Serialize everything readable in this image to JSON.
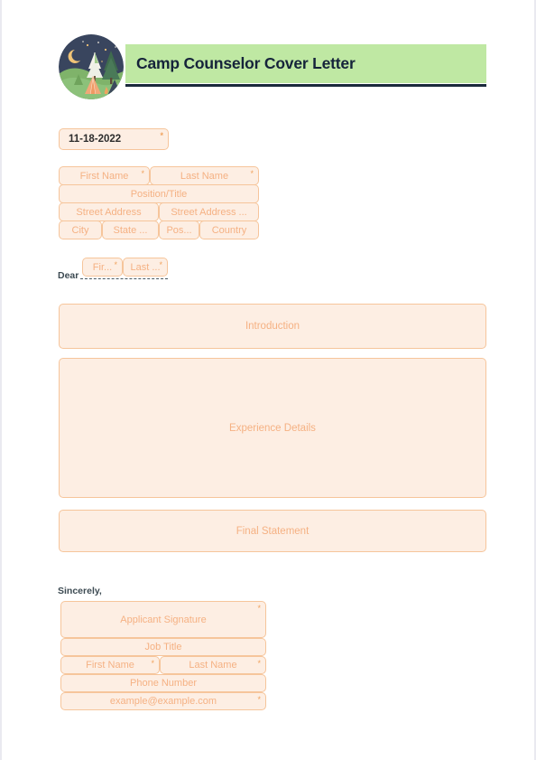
{
  "document": {
    "title": "Camp Counselor Cover Letter",
    "logo_icon": "campsite-night-scene-icon",
    "accent_color": "#bfe8a3",
    "field_border_color": "#f6c59b",
    "field_fill_color": "#fdeee3",
    "placeholder_color": "#f5b183",
    "required_marker": "*"
  },
  "date_field": {
    "name": "date",
    "value": "11-18-2022",
    "required": true
  },
  "recipient_address": {
    "row1": [
      {
        "placeholder": "First Name",
        "required": true
      },
      {
        "placeholder": "Last Name",
        "required": true
      }
    ],
    "row2": [
      {
        "placeholder": "Position/Title",
        "required": false
      }
    ],
    "row3": [
      {
        "placeholder": "Street Address",
        "required": false
      },
      {
        "placeholder": "Street Address ...",
        "required": false
      }
    ],
    "row4": [
      {
        "placeholder": "City",
        "required": false
      },
      {
        "placeholder": "State ...",
        "required": false
      },
      {
        "placeholder": "Pos...",
        "required": false
      },
      {
        "placeholder": "Country",
        "required": false
      }
    ]
  },
  "salutation": {
    "label": "Dear",
    "fields": [
      {
        "placeholder": "Fir...",
        "required": true
      },
      {
        "placeholder": "Last ...",
        "required": true
      }
    ]
  },
  "body": {
    "introduction": {
      "placeholder": "Introduction",
      "required": false
    },
    "experience": {
      "placeholder": "Experience Details",
      "required": false
    },
    "final_statement": {
      "placeholder": "Final Statement",
      "required": false
    }
  },
  "closing": {
    "label": "Sincerely,"
  },
  "signature_block": {
    "signature": {
      "placeholder": "Applicant Signature",
      "required": true
    },
    "job_title": {
      "placeholder": "Job Title",
      "required": false
    },
    "name_row": [
      {
        "placeholder": "First Name",
        "required": true
      },
      {
        "placeholder": "Last Name",
        "required": true
      }
    ],
    "phone": {
      "placeholder": "Phone Number",
      "required": false
    },
    "email": {
      "placeholder": "example@example.com",
      "required": true
    }
  }
}
